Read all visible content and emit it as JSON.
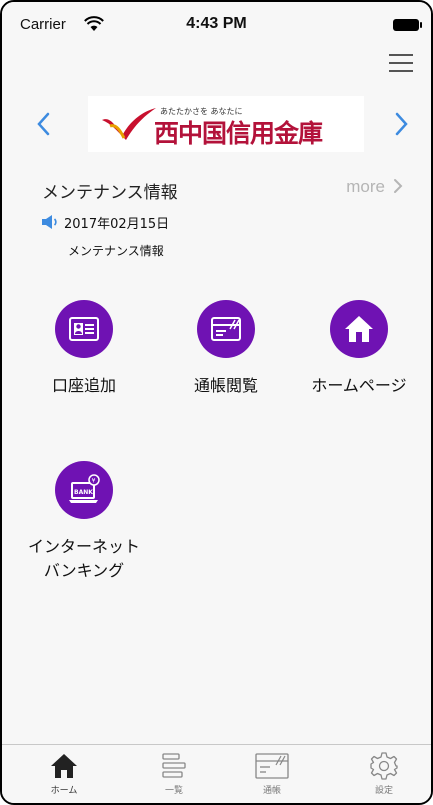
{
  "status_bar": {
    "carrier": "Carrier",
    "time": "4:43 PM"
  },
  "banner": {
    "logo_tagline": "あたたかさを あなたに",
    "logo_name": "西中国信用金庫"
  },
  "maintenance": {
    "title": "メンテナンス情報",
    "more_label": "more",
    "items": [
      {
        "date": "2017年02月15日",
        "text": "メンテナンス情報"
      }
    ]
  },
  "menu": [
    {
      "label": "口座追加",
      "icon": "id-card-icon"
    },
    {
      "label": "通帳閲覧",
      "icon": "passbook-icon"
    },
    {
      "label": "ホームページ",
      "icon": "home-icon"
    },
    {
      "label_line1": "インターネット",
      "label_line2": "バンキング",
      "icon": "bank-laptop-icon"
    }
  ],
  "tabbar": {
    "tabs": [
      {
        "label": "ホーム",
        "icon": "home-icon",
        "active": true
      },
      {
        "label": "一覧",
        "icon": "list-icon",
        "active": false
      },
      {
        "label": "通帳",
        "icon": "passbook-icon",
        "active": false
      },
      {
        "label": "設定",
        "icon": "gear-icon",
        "active": false
      }
    ]
  },
  "colors": {
    "accent": "#6f12b3",
    "brand": "#b3123a",
    "chevron": "#3d8be0"
  }
}
